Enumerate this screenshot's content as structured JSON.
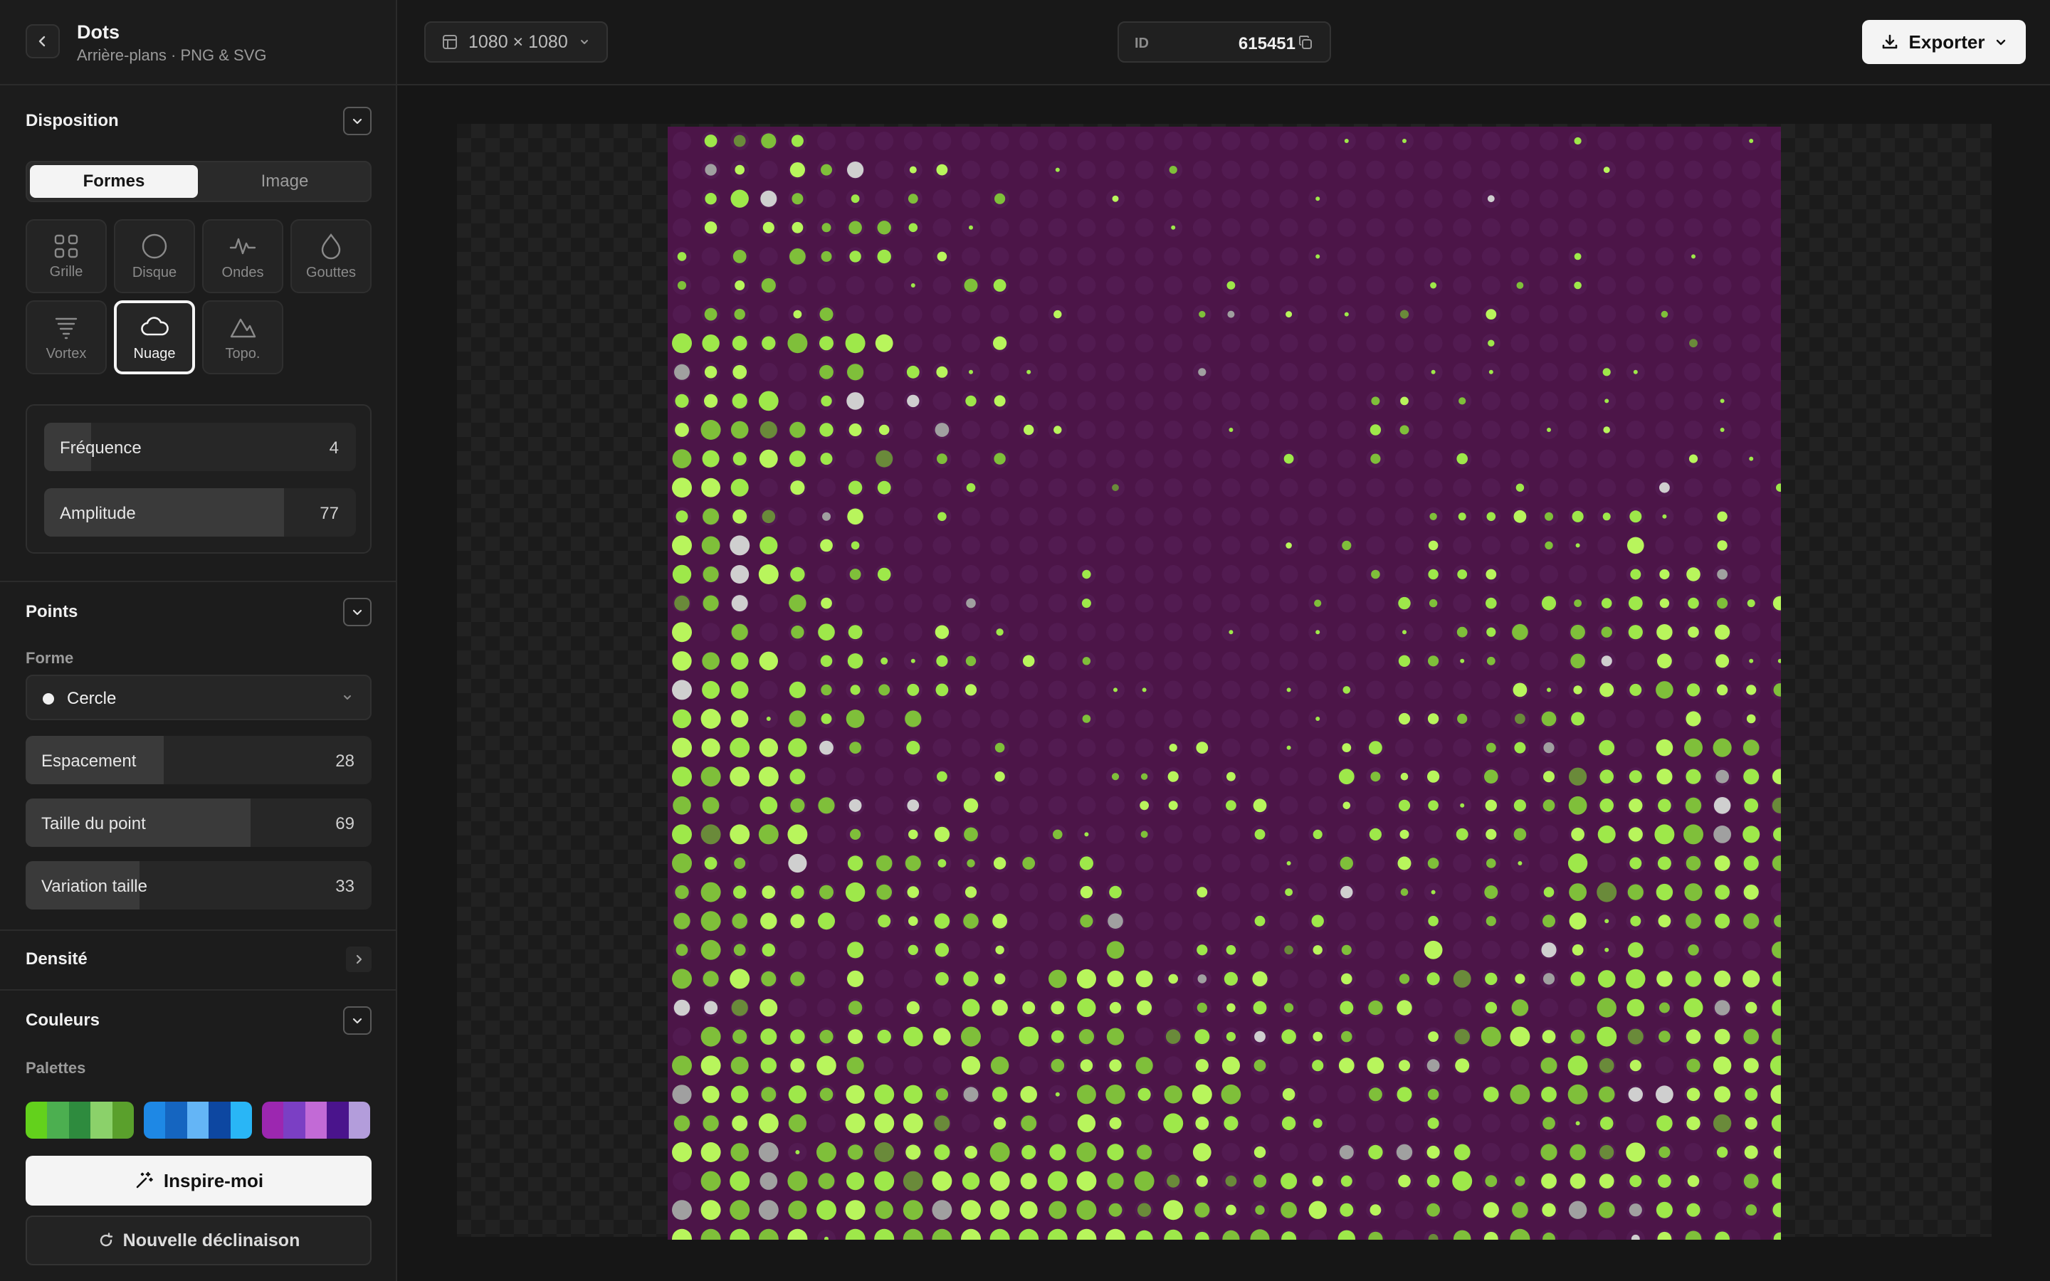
{
  "header": {
    "title": "Dots",
    "subtitle": "Arrière-plans · PNG & SVG"
  },
  "topbar": {
    "size_label": "1080 × 1080",
    "id_label": "ID",
    "id_value": "615451",
    "export_label": "Exporter"
  },
  "layout": {
    "title": "Disposition",
    "mode_tabs": [
      {
        "label": "Formes",
        "active": true
      },
      {
        "label": "Image",
        "active": false
      }
    ],
    "shapes": [
      {
        "label": "Grille",
        "icon": "grid-icon",
        "active": false
      },
      {
        "label": "Disque",
        "icon": "circle-icon",
        "active": false
      },
      {
        "label": "Ondes",
        "icon": "wave-icon",
        "active": false
      },
      {
        "label": "Gouttes",
        "icon": "drop-icon",
        "active": false
      },
      {
        "label": "Vortex",
        "icon": "vortex-icon",
        "active": false
      },
      {
        "label": "Nuage",
        "icon": "cloud-icon",
        "active": true
      },
      {
        "label": "Topo.",
        "icon": "mountain-icon",
        "active": false
      }
    ],
    "sliders": [
      {
        "label": "Fréquence",
        "value": "4",
        "fraction": 0.15
      },
      {
        "label": "Amplitude",
        "value": "77",
        "fraction": 0.77
      }
    ]
  },
  "points": {
    "title": "Points",
    "shape_label": "Forme",
    "shape_value": "Cercle",
    "sliders": [
      {
        "label": "Espacement",
        "value": "28",
        "fraction": 0.4
      },
      {
        "label": "Taille du point",
        "value": "69",
        "fraction": 0.65
      },
      {
        "label": "Variation taille",
        "value": "33",
        "fraction": 0.33
      }
    ]
  },
  "density": {
    "title": "Densité"
  },
  "colors": {
    "title": "Couleurs",
    "palettes_label": "Palettes",
    "palettes": [
      [
        "#63d11c",
        "#4caf50",
        "#2e8b3e",
        "#8bd16a",
        "#5aa02c"
      ],
      [
        "#1e88e5",
        "#1565c0",
        "#64b5f6",
        "#0d47a1",
        "#29b6f6"
      ],
      [
        "#9c27b0",
        "#7b3fc4",
        "#c26ad6",
        "#4a148c",
        "#b39ddb"
      ]
    ]
  },
  "actions": {
    "inspire_label": "Inspire-moi",
    "variation_label": "Nouvelle déclinaison"
  },
  "artwork": {
    "background": "#4c1548",
    "colors": [
      "#9ee84a",
      "#b8f55c",
      "#7fbf3a",
      "#a0a0a0",
      "#cfcfcf",
      "#6a8a3a"
    ]
  }
}
